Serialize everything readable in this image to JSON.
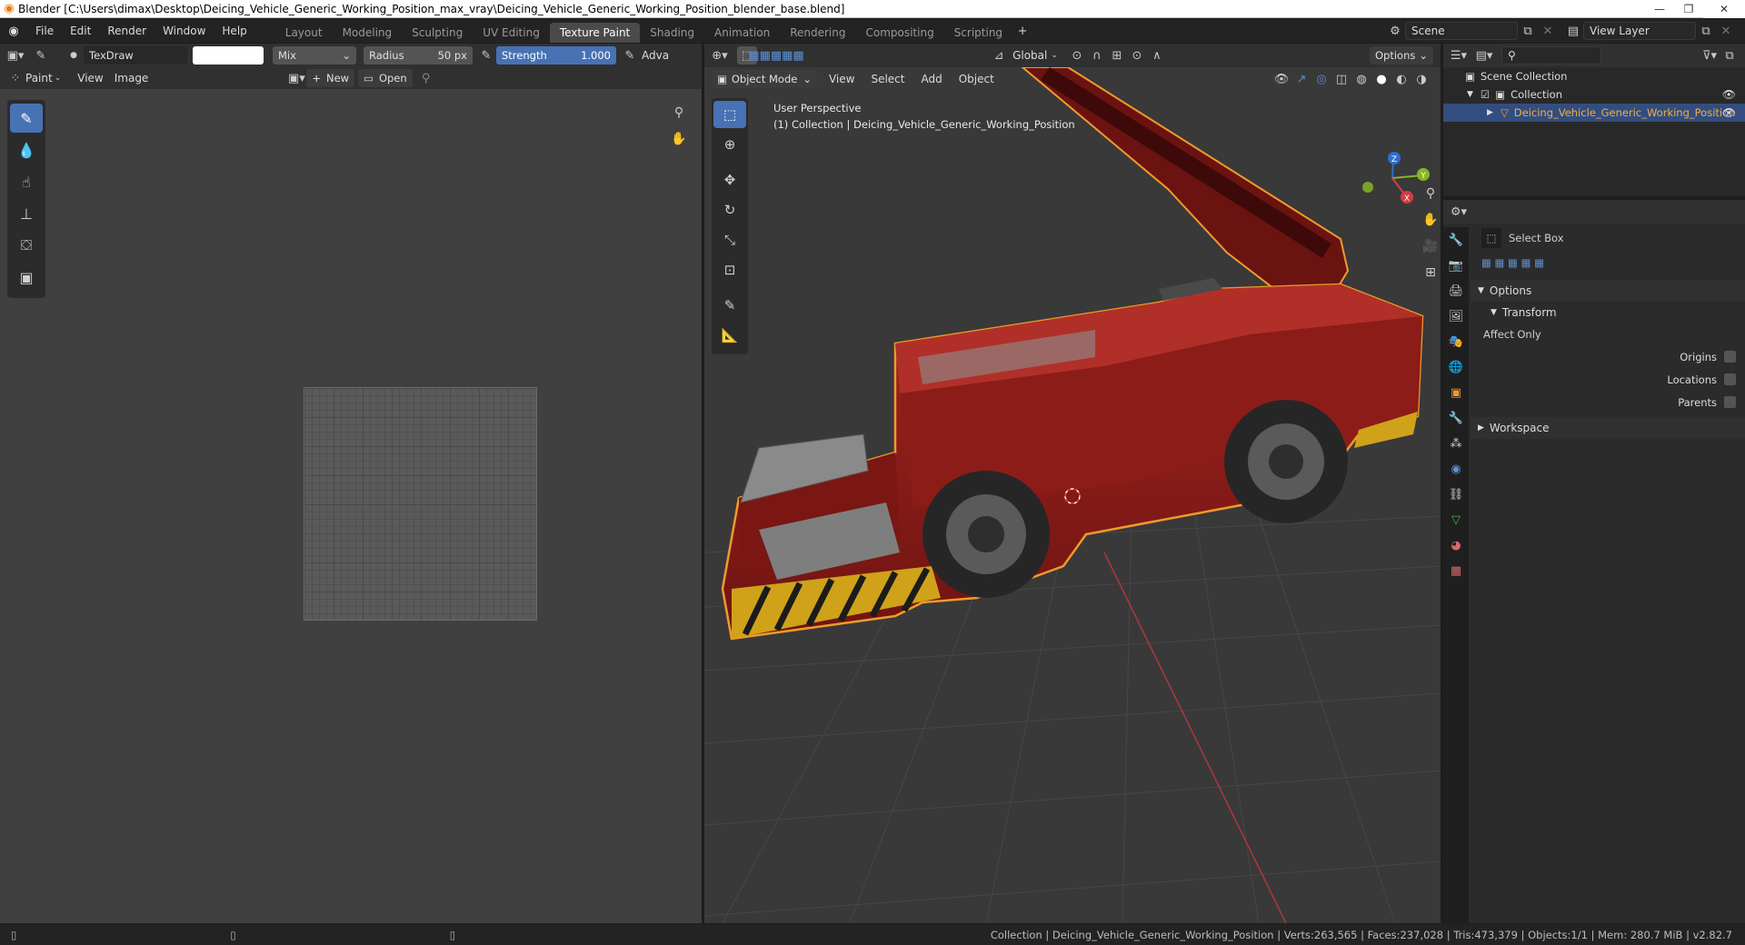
{
  "window": {
    "title": "Blender [C:\\Users\\dimax\\Desktop\\Deicing_Vehicle_Generic_Working_Position_max_vray\\Deicing_Vehicle_Generic_Working_Position_blender_base.blend]"
  },
  "menu": [
    "File",
    "Edit",
    "Render",
    "Window",
    "Help"
  ],
  "workspaces": [
    "Layout",
    "Modeling",
    "Sculpting",
    "UV Editing",
    "Texture Paint",
    "Shading",
    "Animation",
    "Rendering",
    "Compositing",
    "Scripting"
  ],
  "active_workspace": "Texture Paint",
  "scene": {
    "name": "Scene",
    "view_layer": "View Layer"
  },
  "image_editor": {
    "brush": "TexDraw",
    "blend": "Mix",
    "radius_label": "Radius",
    "radius_value": "50 px",
    "strength_label": "Strength",
    "strength_value": "1.000",
    "adv_label": "Adva",
    "mode": "Paint",
    "view": "View",
    "image": "Image",
    "new": "New",
    "open": "Open"
  },
  "viewport": {
    "mode": "Object Mode",
    "menus": [
      "View",
      "Select",
      "Add",
      "Object"
    ],
    "orientation": "Global",
    "options": "Options",
    "perspective": "User Perspective",
    "collection_line": "(1) Collection | Deicing_Vehicle_Generic_Working_Position",
    "axis_x": "X",
    "axis_y": "Y",
    "axis_z": "Z",
    "colors": {
      "body": "#8e1a16",
      "outline": "#f09a2b",
      "grid": "#444444",
      "x_axis": "#b0373b"
    }
  },
  "outliner": {
    "scene_collection": "Scene Collection",
    "collection": "Collection",
    "object": "Deicing_Vehicle_Generic_Working_Position"
  },
  "properties": {
    "tool": "Select Box",
    "options": "Options",
    "transform": "Transform",
    "affect_only": "Affect Only",
    "origins": "Origins",
    "locations": "Locations",
    "parents": "Parents",
    "workspace": "Workspace"
  },
  "status": {
    "text": "Collection | Deicing_Vehicle_Generic_Working_Position | Verts:263,565 | Faces:237,028 | Tris:473,379 | Objects:1/1 | Mem: 280.7 MiB | v2.82.7"
  }
}
